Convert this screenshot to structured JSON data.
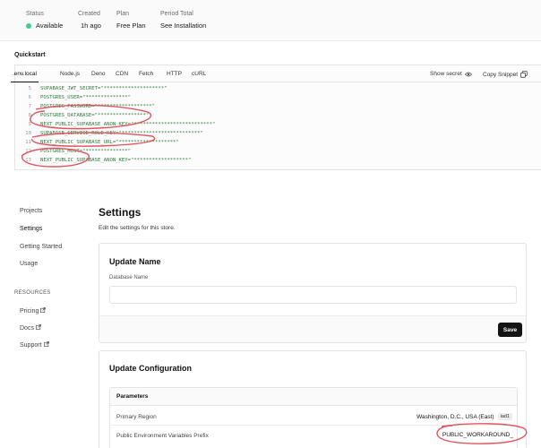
{
  "stats": [
    {
      "label": "Status",
      "value": "Available",
      "color": "#3ecf8e"
    },
    {
      "label": "Created",
      "value": "1h ago"
    },
    {
      "label": "Plan",
      "value": "Free Plan"
    },
    {
      "label": "Period Total",
      "value": "See Installation"
    }
  ],
  "quickstart": {
    "title": "Quickstart",
    "tabs": [
      ".env.local",
      "Node.js",
      "Deno",
      "CDN",
      "Fetch",
      "HTTP",
      "cURL"
    ],
    "active_tab": ".env.local",
    "show_secret": "Show secret",
    "copy_snippet": "Copy Snippet",
    "code_lines": [
      {
        "n": "5",
        "text": "SUPABASE_JWT_SECRET=\"********************\""
      },
      {
        "n": "6",
        "text": "POSTGRES_USER=\"**************\""
      },
      {
        "n": "7",
        "text": "POSTGRES_PASSWORD=\"******************\""
      },
      {
        "n": "8",
        "text": "POSTGRES_DATABASE=\"****************\""
      },
      {
        "n": "9",
        "text": "NEXT_PUBLIC_SUPABASE_ANON_KEY=\"**************************\""
      },
      {
        "n": "10",
        "text": "SUPABASE_SERVICE_ROLE_KEY=\"**************************\""
      },
      {
        "n": "11",
        "text": "NEXT_PUBLIC_SUPABASE_URL=\"*******************\""
      },
      {
        "n": "12",
        "text": "POSTGRES_HOST=\"**************\""
      },
      {
        "n": "13",
        "text": "NEXT_PUBLIC_SUPABASE_ANON_KEY=\"******************\""
      }
    ]
  },
  "sidebar": {
    "items": [
      "Projects",
      "Settings",
      "Getting Started",
      "Usage"
    ],
    "active": "Settings",
    "resources_heading": "RESOURCES",
    "resources": [
      "Pricing",
      "Docs",
      "Support"
    ]
  },
  "main": {
    "title": "Settings",
    "subtitle": "Edit the settings for this store."
  },
  "update_name": {
    "title": "Update Name",
    "field_label": "Database Name",
    "field_value": "",
    "save": "Save"
  },
  "update_config": {
    "title": "Update Configuration",
    "params_heading": "Parameters",
    "region_label": "Primary Region",
    "region_value": "Washington, D.C., USA (East)",
    "region_code": "iad1",
    "prefix_label": "Public Environment Variables Prefix",
    "prefix_value": "PUBLIC_WORKAROUND_"
  },
  "annotation_color": "#e05560"
}
